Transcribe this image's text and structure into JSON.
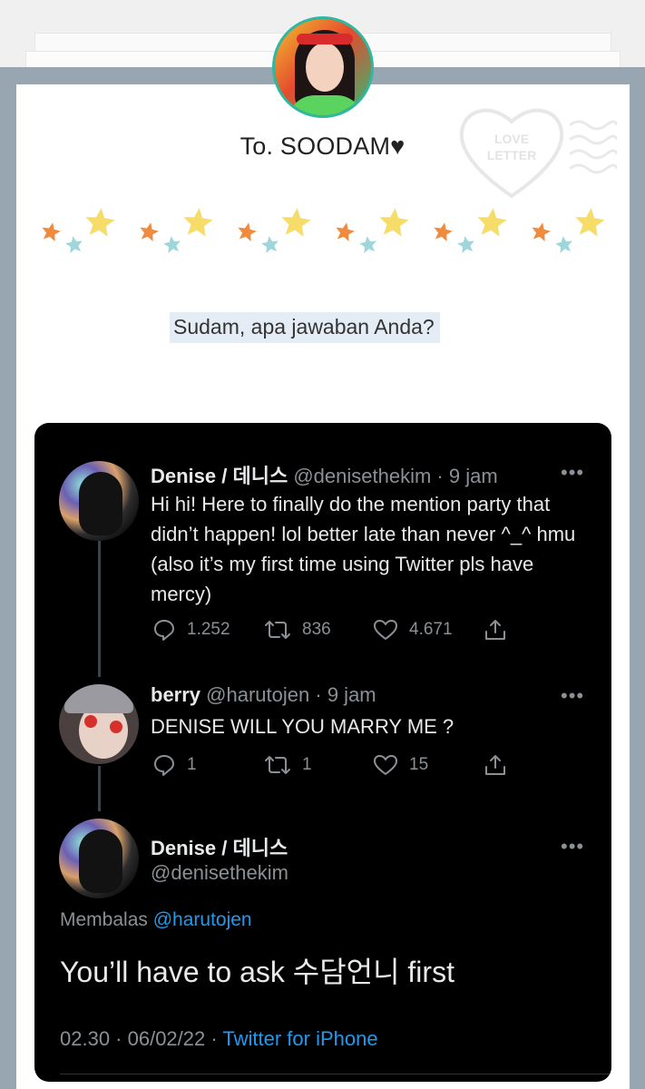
{
  "letter": {
    "title": "To. SOODAM♥",
    "stamp_text_line1": "LOVE",
    "stamp_text_line2": "LETTER",
    "question": "Sudam, apa jawaban Anda?"
  },
  "colors": {
    "frame": "#98a6b1",
    "tweet_bg": "#000000",
    "link": "#1d9bf0",
    "muted": "#8b9095",
    "star_orange": "#f08a3c",
    "star_yellow": "#f6dc68",
    "star_teal": "#9fd6d9"
  },
  "thread": {
    "tweet1": {
      "name": "Denise / 데니스",
      "handle": "@denisethekim",
      "time": "9 jam",
      "text": "Hi hi! Here to finally do the mention party that didn’t happen! lol better late than never ^_^ hmu (also it’s my first time using Twitter pls have mercy)",
      "replies": "1.252",
      "retweets": "836",
      "likes": "4.671"
    },
    "tweet2": {
      "name": "berry",
      "handle": "@harutojen",
      "time": "9 jam",
      "text": "DENISE WILL YOU MARRY ME ?",
      "replies": "1",
      "retweets": "1",
      "likes": "15"
    },
    "tweet3": {
      "name": "Denise / 데니스",
      "handle": "@denisethekim",
      "replying_label": "Membalas",
      "replying_to": "@harutojen",
      "text": "You’ll have to ask 수담언니 first",
      "timestamp": "02.30 · 06/02/22 ·",
      "source": "Twitter for iPhone"
    },
    "more_icon": "more-dots-icon",
    "separator": "·"
  }
}
